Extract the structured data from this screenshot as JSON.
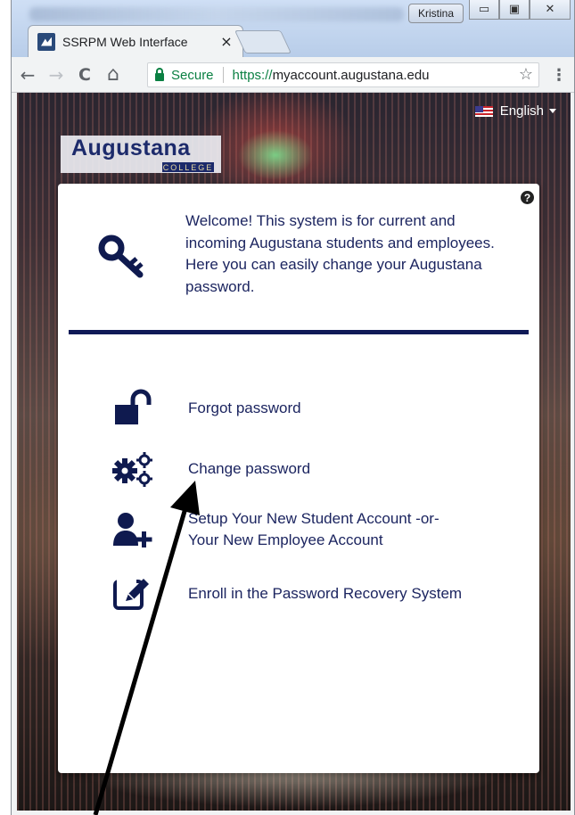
{
  "browser": {
    "tab_title": "SSRPM Web Interface",
    "tab_close": "×",
    "profile_name": "Kristina",
    "window_buttons": {
      "minimize": "▭",
      "maximize": "▣",
      "close": "✕"
    },
    "nav": {
      "back": "←",
      "forward": "→",
      "reload": "C",
      "home": "⌂"
    },
    "secure_label": "Secure",
    "url_scheme": "https://",
    "url_host": "myaccount.augustana.edu",
    "bookmark_icon": "☆",
    "menu_icon": "⋮"
  },
  "page": {
    "language": "English",
    "logo_text": "Augustana",
    "logo_subtext": "COLLEGE",
    "help_icon": "?",
    "welcome_text": "Welcome! This system is for current and incoming Augustana students and employees. Here you can easily change your Augustana password.",
    "actions": [
      {
        "label": "Forgot password",
        "icon": "unlock-icon"
      },
      {
        "label": "Change password",
        "icon": "gears-icon"
      },
      {
        "label": "Setup Your New Student Account -or-",
        "label2": "Your New Employee Account",
        "icon": "user-plus-icon"
      },
      {
        "label": "Enroll in the Password Recovery System",
        "icon": "edit-icon"
      }
    ],
    "accent_color": "#101a57"
  }
}
